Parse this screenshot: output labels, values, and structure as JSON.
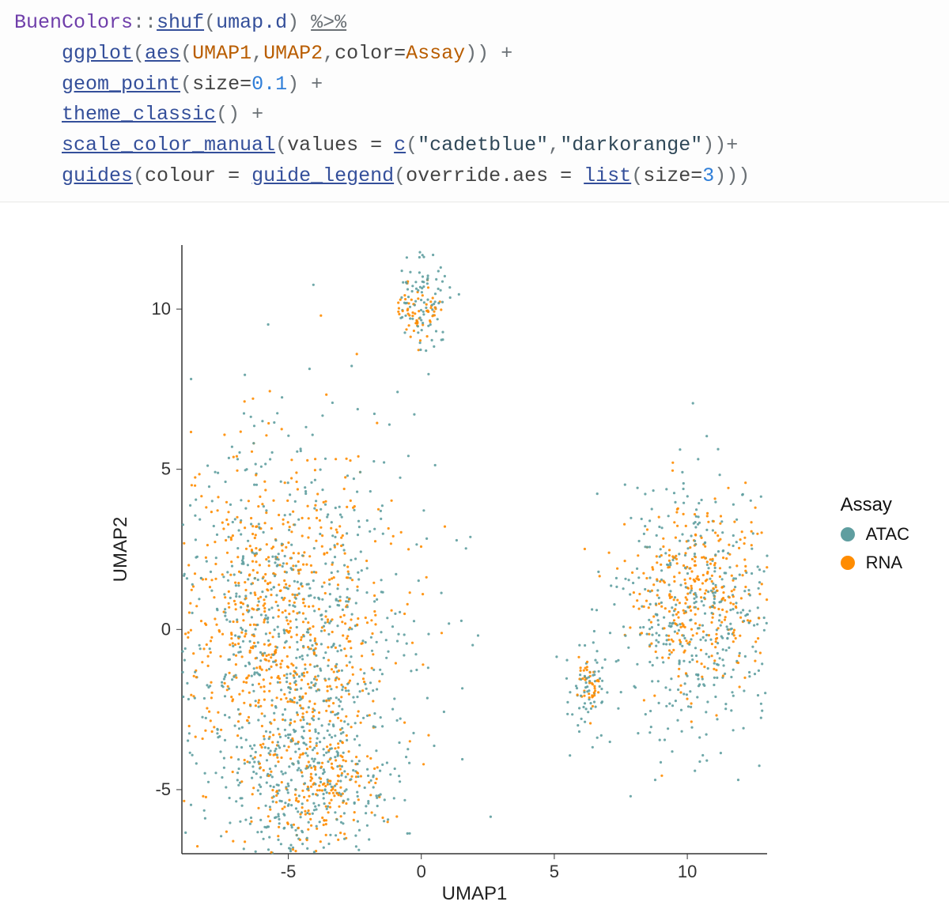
{
  "code": {
    "indent": "    ",
    "tokens": {
      "pkg": "BuenColors",
      "sep": "::",
      "shuf": "shuf",
      "umapd": "umap.d",
      "pipe": "%>%",
      "ggplot": "ggplot",
      "aes": "aes",
      "UMAP1": "UMAP1",
      "UMAP2": "UMAP2",
      "color_kw": "color=",
      "Assay": "Assay",
      "plus": " +",
      "geom_point": "geom_point",
      "size_kw": "size=",
      "size_val": "0.1",
      "theme_classic": "theme_classic",
      "scale_color_manual": "scale_color_manual",
      "values_kw": "values = ",
      "c": "c",
      "cadetblue": "\"cadetblue\"",
      "darkorange": "\"darkorange\"",
      "guides": "guides",
      "colour_kw": "colour = ",
      "guide_legend": "guide_legend",
      "override": "override.aes = ",
      "list": "list",
      "size3": "3"
    }
  },
  "chart_data": {
    "type": "scatter",
    "title": "",
    "xlabel": "UMAP1",
    "ylabel": "UMAP2",
    "xlim": [
      -9,
      13
    ],
    "ylim": [
      -7,
      12
    ],
    "x_ticks": [
      -5,
      0,
      5,
      10
    ],
    "y_ticks": [
      -5,
      0,
      5,
      10
    ],
    "legend": {
      "title": "Assay",
      "position": "right",
      "items": [
        {
          "name": "ATAC",
          "color": "#5f9ea0"
        },
        {
          "name": "RNA",
          "color": "#ff8c00"
        }
      ]
    },
    "series": [
      {
        "name": "ATAC",
        "color": "#5f9ea0",
        "clusters": [
          {
            "cx": -5.0,
            "cy": -0.5,
            "n": 800,
            "sdx": 2.6,
            "sdy": 3.3
          },
          {
            "cx": -4.0,
            "cy": -5.0,
            "n": 250,
            "sdx": 1.5,
            "sdy": 1.4
          },
          {
            "cx": 10.5,
            "cy": 0.3,
            "n": 450,
            "sdx": 1.8,
            "sdy": 2.1
          },
          {
            "cx": 0.0,
            "cy": 10.3,
            "n": 90,
            "sdx": 0.6,
            "sdy": 0.7
          },
          {
            "cx": 6.3,
            "cy": -2.0,
            "n": 55,
            "sdx": 0.35,
            "sdy": 0.7
          }
        ]
      },
      {
        "name": "RNA",
        "color": "#ff8c00",
        "clusters": [
          {
            "cx": -5.2,
            "cy": 0.0,
            "n": 700,
            "sdx": 2.1,
            "sdy": 2.7
          },
          {
            "cx": -3.8,
            "cy": -5.0,
            "n": 180,
            "sdx": 1.1,
            "sdy": 1.0
          },
          {
            "cx": 10.3,
            "cy": 1.2,
            "n": 320,
            "sdx": 1.2,
            "sdy": 1.5
          },
          {
            "cx": 0.0,
            "cy": 10.0,
            "n": 60,
            "sdx": 0.4,
            "sdy": 0.45
          },
          {
            "cx": 6.3,
            "cy": -1.9,
            "n": 40,
            "sdx": 0.25,
            "sdy": 0.5
          }
        ]
      }
    ]
  }
}
